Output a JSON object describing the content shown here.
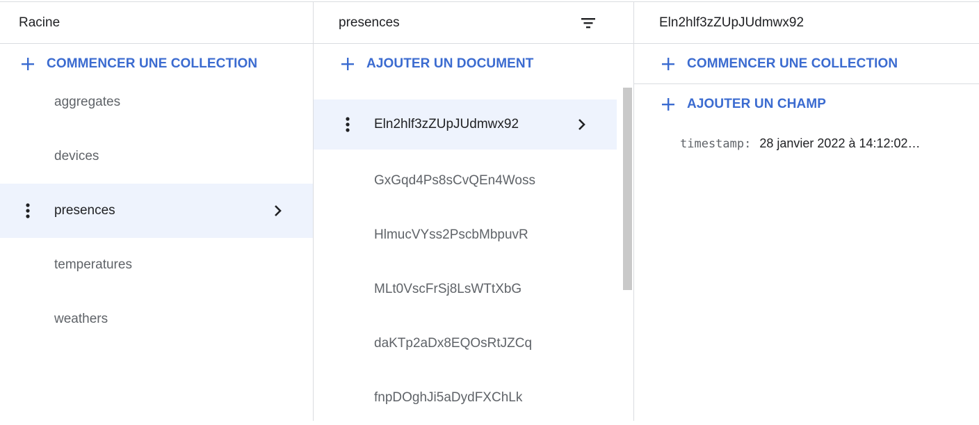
{
  "root_panel": {
    "title": "Racine",
    "start_collection_label": "COMMENCER UNE COLLECTION",
    "collections": [
      {
        "label": "aggregates",
        "selected": false
      },
      {
        "label": "devices",
        "selected": false
      },
      {
        "label": "presences",
        "selected": true
      },
      {
        "label": "temperatures",
        "selected": false
      },
      {
        "label": "weathers",
        "selected": false
      }
    ]
  },
  "collection_panel": {
    "title": "presences",
    "add_document_label": "AJOUTER UN DOCUMENT",
    "documents": [
      {
        "id": "Eln2hlf3zZUpJUdmwx92",
        "selected": true
      },
      {
        "id": "GxGqd4Ps8sCvQEn4Woss",
        "selected": false
      },
      {
        "id": "HlmucVYss2PscbMbpuvR",
        "selected": false
      },
      {
        "id": "MLt0VscFrSj8LsWTtXbG",
        "selected": false
      },
      {
        "id": "daKTp2aDx8EQOsRtJZCq",
        "selected": false
      },
      {
        "id": "fnpDOghJi5aDydFXChLk",
        "selected": false
      }
    ]
  },
  "document_panel": {
    "title": "Eln2hlf3zZUpJUdmwx92",
    "start_collection_label": "COMMENCER UNE COLLECTION",
    "add_field_label": "AJOUTER UN CHAMP",
    "fields": [
      {
        "key": "timestamp",
        "separator": ":",
        "value": "28 janvier 2022 à 14:12:02…"
      }
    ]
  },
  "colors": {
    "accent": "#3b6bd0",
    "selected_row_bg": "#eef3fd",
    "divider": "#dadce0",
    "muted_text": "#5f6368"
  },
  "icons": {
    "add": "plus-icon",
    "menu": "more-vert-icon",
    "open": "chevron-right-icon",
    "filter": "filter-list-icon"
  }
}
